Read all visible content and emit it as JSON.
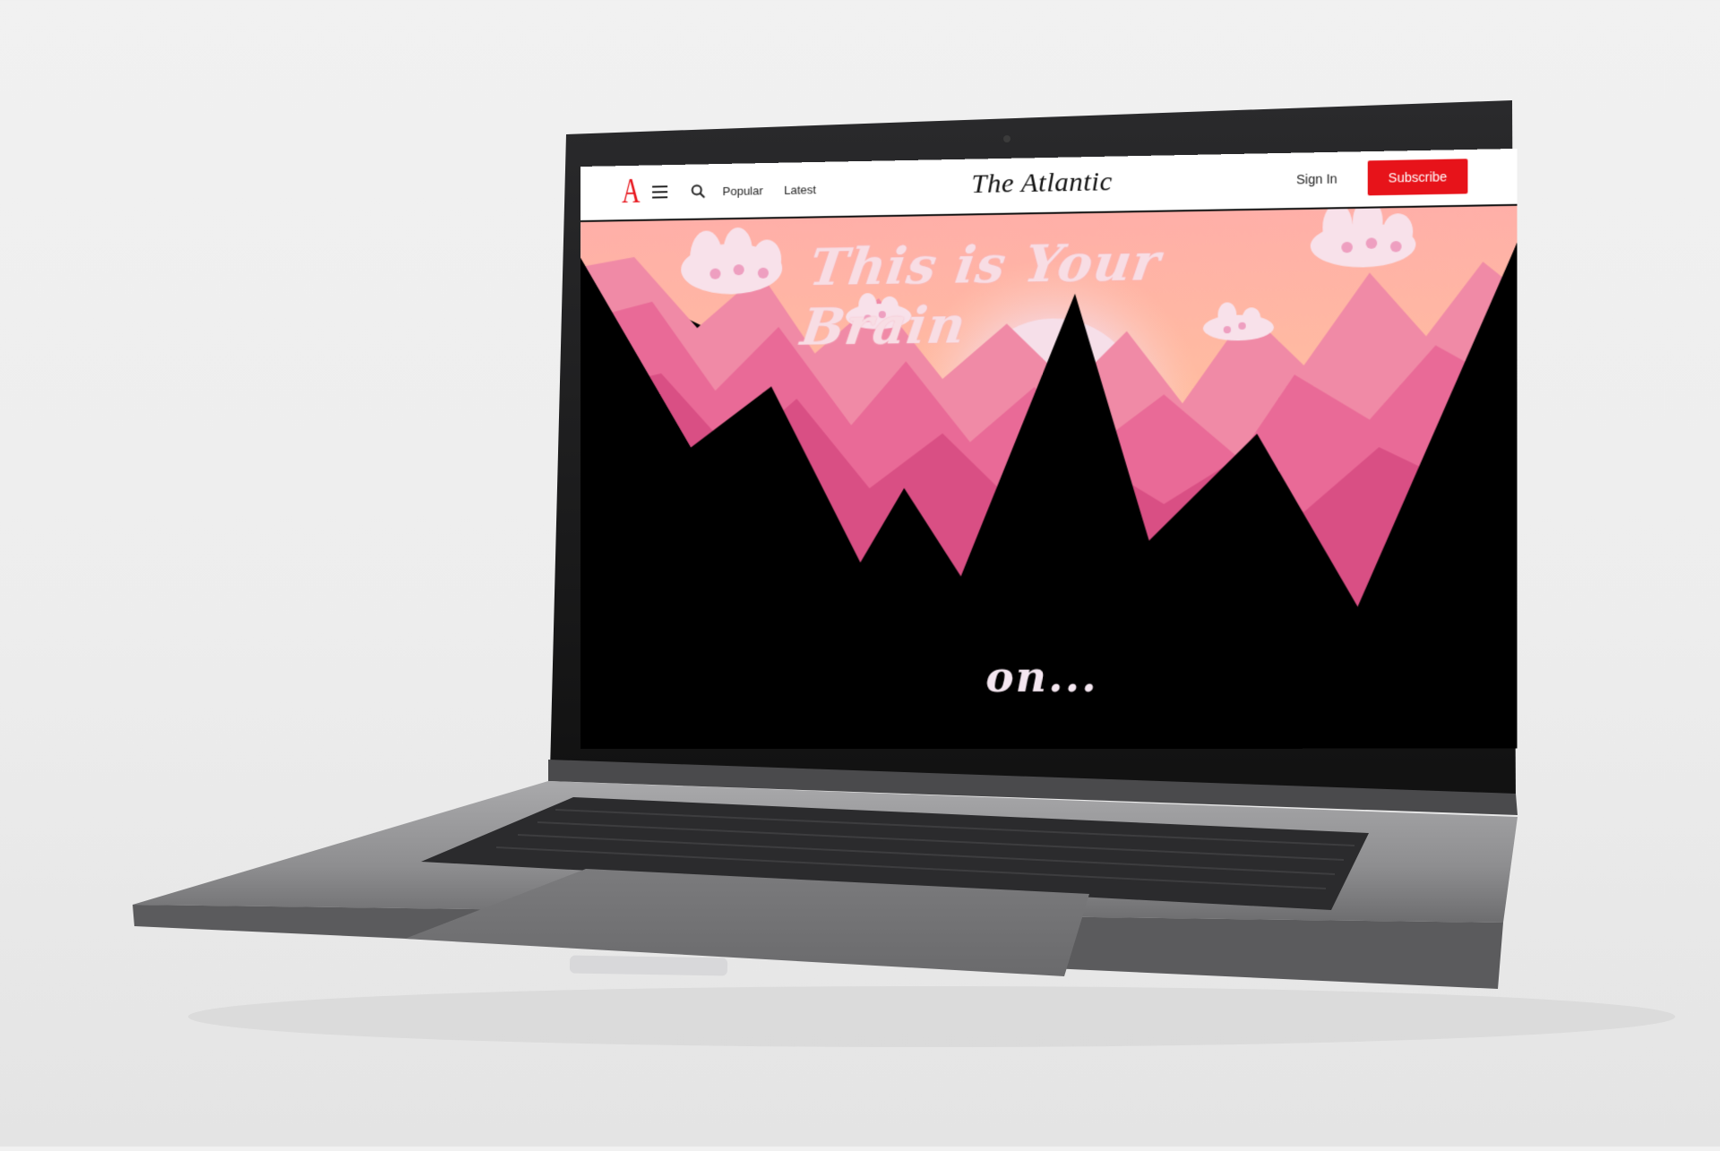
{
  "browser": {
    "logo": "A",
    "nav": [
      {
        "label": "Popular"
      },
      {
        "label": "Latest"
      }
    ],
    "brand": "The Atlantic",
    "signin_label": "Sign In",
    "subscribe_label": "Subscribe",
    "icons": {
      "menu": "hamburger-icon",
      "search": "search-icon"
    }
  },
  "hero": {
    "title": "This is Your Brain",
    "subtitle": "on..."
  },
  "colors": {
    "accent": "#e7131a",
    "sky": "#ffb0a8",
    "mountains": "#e95b8e"
  }
}
